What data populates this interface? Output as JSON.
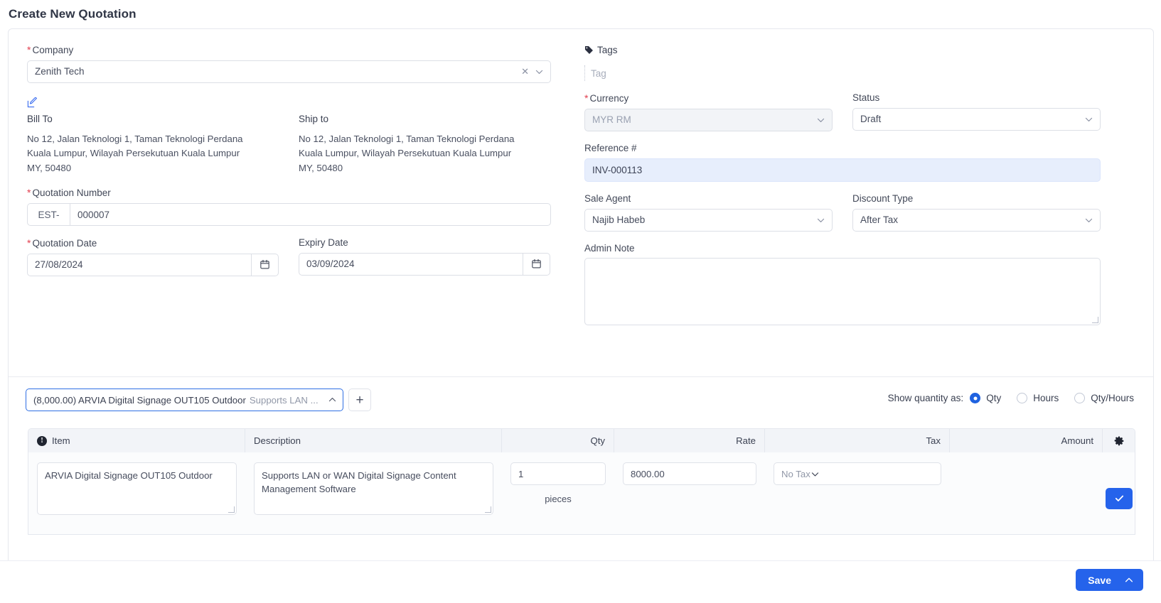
{
  "page": {
    "title": "Create New Quotation"
  },
  "left": {
    "company": {
      "label": "Company",
      "required": true,
      "value": "Zenith Tech",
      "clear_icon": "close-icon",
      "chevron_icon": "chevron-down-icon"
    },
    "edit_icon": "edit-pencil-icon",
    "bill_to": {
      "label": "Bill To",
      "address": "No 12, Jalan Teknologi 1, Taman Teknologi Perdana\nKuala Lumpur, Wilayah Persekutuan Kuala Lumpur\nMY, 50480"
    },
    "ship_to": {
      "label": "Ship to",
      "address": "No 12, Jalan Teknologi 1, Taman Teknologi Perdana\nKuala Lumpur, Wilayah Persekutuan Kuala Lumpur\nMY, 50480"
    },
    "quotation_number": {
      "label": "Quotation Number",
      "required": true,
      "prefix": "EST-",
      "value": "000007"
    },
    "quotation_date": {
      "label": "Quotation Date",
      "required": true,
      "value": "27/08/2024",
      "icon": "calendar-icon"
    },
    "expiry_date": {
      "label": "Expiry Date",
      "required": false,
      "value": "03/09/2024",
      "icon": "calendar-icon"
    }
  },
  "right": {
    "tags": {
      "label": "Tags",
      "icon": "tag-icon",
      "placeholder": "Tag",
      "value": ""
    },
    "currency": {
      "label": "Currency",
      "required": true,
      "value": "MYR RM",
      "disabled": true
    },
    "status": {
      "label": "Status",
      "value": "Draft"
    },
    "reference": {
      "label": "Reference #",
      "value": "INV-000113",
      "highlight_color": "#e7eefc"
    },
    "sale_agent": {
      "label": "Sale Agent",
      "value": "Najib Habeb"
    },
    "discount_type": {
      "label": "Discount Type",
      "value": "After Tax"
    },
    "admin_note": {
      "label": "Admin Note",
      "value": "",
      "placeholder": ""
    }
  },
  "items_section": {
    "picker": {
      "main_text": "(8,000.00) ARVIA Digital Signage OUT105 Outdoor",
      "sub_text": "Supports LAN ...",
      "chevron_icon": "chevron-up-icon"
    },
    "add_button": {
      "label": "+",
      "icon": "plus-icon"
    },
    "quantity_mode": {
      "label": "Show quantity as:",
      "options": [
        "Qty",
        "Hours",
        "Qty/Hours"
      ],
      "selected": "Qty",
      "accent_color": "#1f62e0"
    },
    "table": {
      "headers": [
        "Item",
        "Description",
        "Qty",
        "Rate",
        "Tax",
        "Amount"
      ],
      "item_info_icon": "info-icon",
      "settings_icon": "gear-icon",
      "rows": [
        {
          "item": "ARVIA Digital Signage OUT105 Outdoor",
          "description": "Supports LAN or WAN Digital Signage Content Management Software",
          "qty": "1",
          "unit": "pieces",
          "rate": "8000.00",
          "tax": "No Tax",
          "amount": "",
          "confirm_icon": "check-icon"
        }
      ]
    }
  },
  "footer": {
    "save_label": "Save",
    "save_caret_icon": "chevron-up-icon",
    "accent_color": "#2563eb"
  }
}
